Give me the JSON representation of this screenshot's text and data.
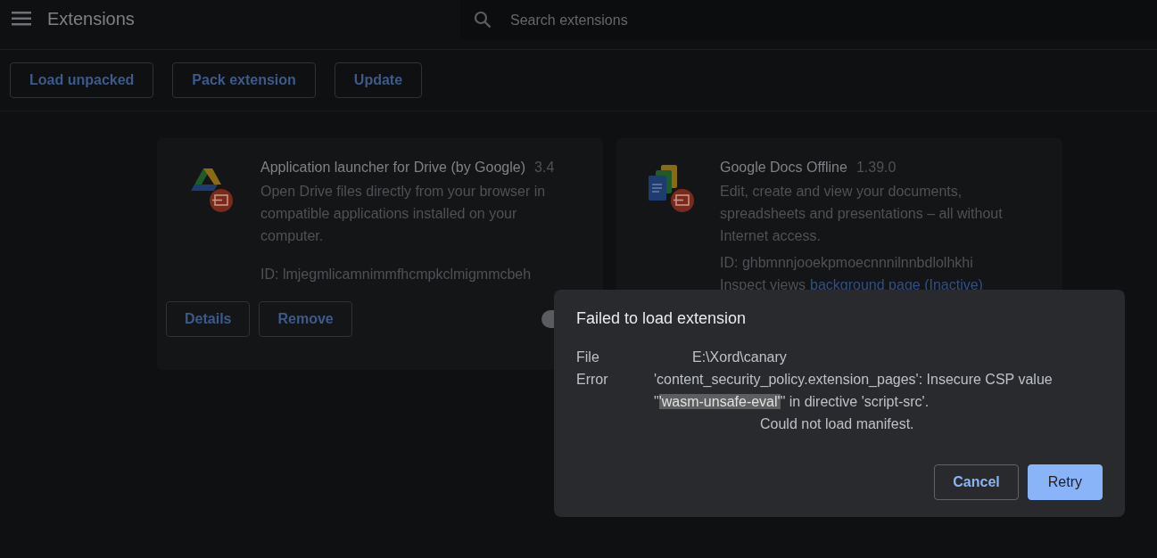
{
  "header": {
    "title": "Extensions",
    "search": {
      "placeholder": "Search extensions"
    }
  },
  "toolbar": {
    "buttons": [
      "Load unpacked",
      "Pack extension",
      "Update"
    ]
  },
  "extensions": [
    {
      "name": "Application launcher for Drive (by Google)",
      "version": "3.4",
      "description": "Open Drive files directly from your browser in compatible applications installed on your computer.",
      "id": "ID: lmjegmlicamnimmfhcmpkclmigmmcbeh",
      "kind": "drive",
      "buttons": [
        "Details",
        "Remove"
      ],
      "enabled": false
    },
    {
      "name": "Google Docs Offline",
      "version": "1.39.0",
      "description": "Edit, create and view your documents, spreadsheets and presentations – all without Internet access.",
      "id": "ID: ghbmnnjooekpmoecnnnilnnbdlolhkhi",
      "kind": "docs",
      "inspect_label": "Inspect views",
      "inspect_link": "background page (Inactive)"
    }
  ],
  "dialog": {
    "title": "Failed to load extension",
    "file_label": "File",
    "file_value": "E:\\Xord\\canary",
    "error_label": "Error",
    "error_line_1": "'content_security_policy.extension_pages': Insecure CSP value",
    "error_line_2_before": "\"",
    "error_line_2_selected": "'wasm-unsafe-eval'",
    "error_line_2_after": "\" in directive 'script-src'.",
    "error_line_3": "Could not load manifest.",
    "buttons": [
      {
        "label": "Cancel",
        "kind": "secondary"
      },
      {
        "label": "Retry",
        "kind": "primary"
      }
    ]
  }
}
